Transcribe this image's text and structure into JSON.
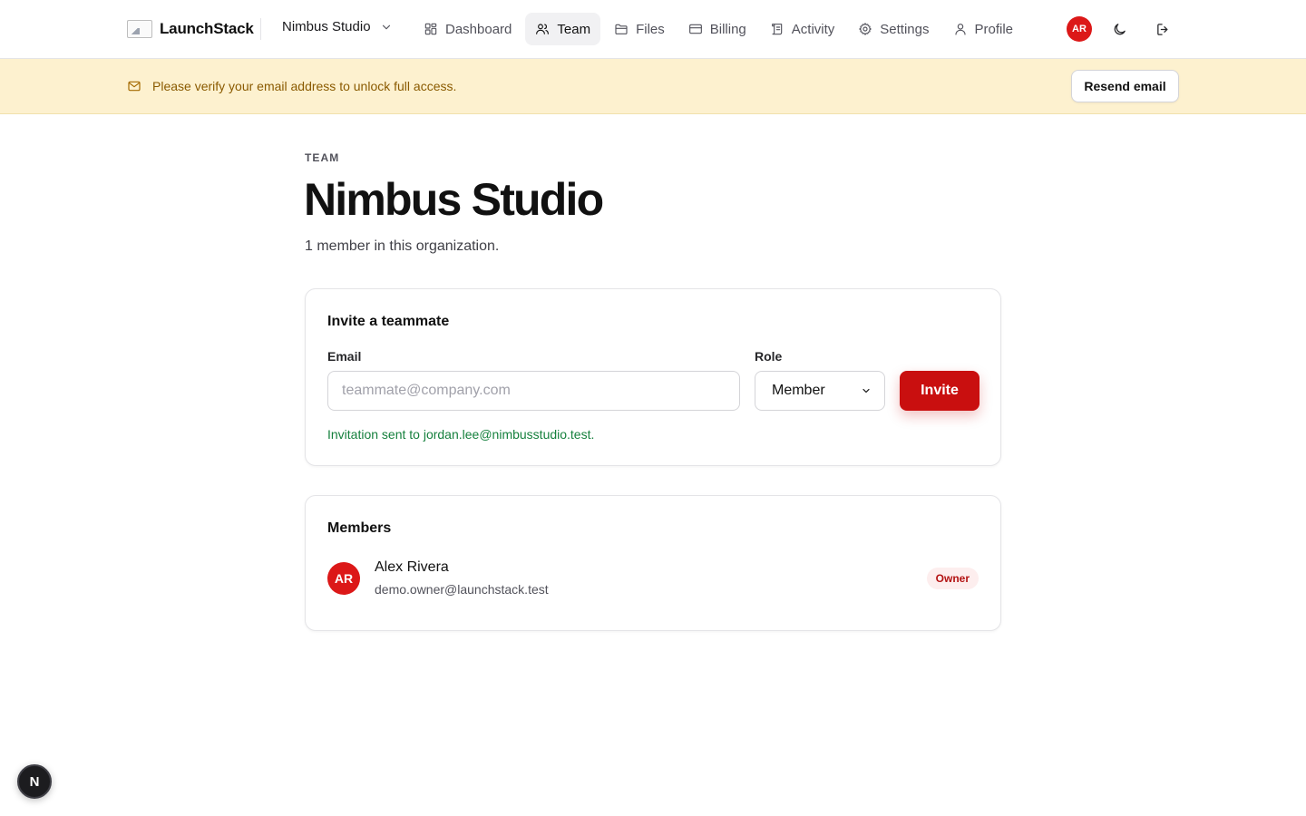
{
  "app": {
    "brand_name": "LaunchStack"
  },
  "header": {
    "org_name": "Nimbus Studio",
    "nav": [
      {
        "label": "Dashboard",
        "icon": "dashboard-icon",
        "active": false
      },
      {
        "label": "Team",
        "icon": "users-icon",
        "active": true
      },
      {
        "label": "Files",
        "icon": "folder-icon",
        "active": false
      },
      {
        "label": "Billing",
        "icon": "credit-card-icon",
        "active": false
      },
      {
        "label": "Activity",
        "icon": "scroll-icon",
        "active": false
      },
      {
        "label": "Settings",
        "icon": "gear-icon",
        "active": false
      },
      {
        "label": "Profile",
        "icon": "user-icon",
        "active": false
      }
    ],
    "user_initials": "AR"
  },
  "banner": {
    "message": "Please verify your email address to unlock full access.",
    "button_label": "Resend email"
  },
  "page": {
    "eyebrow": "TEAM",
    "title": "Nimbus Studio",
    "subtitle": "1 member in this organization."
  },
  "invite": {
    "title": "Invite a teammate",
    "email_label": "Email",
    "email_placeholder": "teammate@company.com",
    "email_value": "",
    "role_label": "Role",
    "role_value": "Member",
    "button_label": "Invite",
    "success_message": "Invitation sent to jordan.lee@nimbusstudio.test."
  },
  "members": {
    "title": "Members",
    "list": [
      {
        "initials": "AR",
        "name": "Alex Rivera",
        "email": "demo.owner@launchstack.test",
        "role": "Owner"
      }
    ]
  },
  "dev_badge": {
    "label": "N"
  },
  "colors": {
    "accent": "#c90f0f",
    "avatar": "#dc1818",
    "banner_bg": "#fdf1cf",
    "banner_text": "#8a5a00",
    "success": "#15803d"
  }
}
